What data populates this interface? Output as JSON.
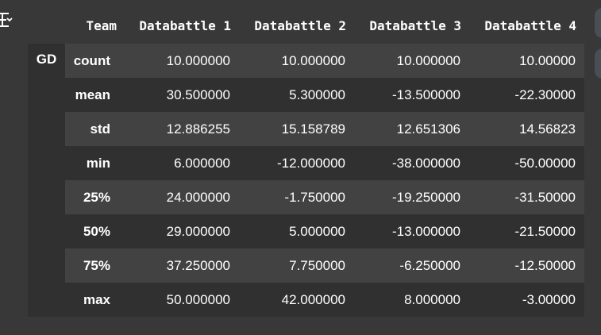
{
  "table": {
    "group_label": "GD",
    "header": {
      "index_name": "Team",
      "columns": [
        "Databattle 1",
        "Databattle 2",
        "Databattle 3",
        "Databattle 4"
      ]
    },
    "rows": [
      {
        "label": "count",
        "cells": [
          "10.000000",
          "10.000000",
          "10.000000",
          "10.00000"
        ]
      },
      {
        "label": "mean",
        "cells": [
          "30.500000",
          "5.300000",
          "-13.500000",
          "-22.30000"
        ]
      },
      {
        "label": "std",
        "cells": [
          "12.886255",
          "15.158789",
          "12.651306",
          "14.56823"
        ]
      },
      {
        "label": "min",
        "cells": [
          "6.000000",
          "-12.000000",
          "-38.000000",
          "-50.00000"
        ]
      },
      {
        "label": "25%",
        "cells": [
          "24.000000",
          "-1.750000",
          "-19.250000",
          "-31.50000"
        ]
      },
      {
        "label": "50%",
        "cells": [
          "29.000000",
          "5.000000",
          "-13.000000",
          "-21.50000"
        ]
      },
      {
        "label": "75%",
        "cells": [
          "37.250000",
          "7.750000",
          "-6.250000",
          "-12.50000"
        ]
      },
      {
        "label": "max",
        "cells": [
          "50.000000",
          "42.000000",
          "8.000000",
          "-3.00000"
        ]
      }
    ]
  },
  "icons": {
    "output_menu": "output-options-icon",
    "side_buttons": [
      "cell-action-button",
      "cell-action-button"
    ]
  },
  "colors": {
    "background": "#383838",
    "row_light": "#424242",
    "row_dark": "#303030",
    "text": "#ffffff"
  }
}
